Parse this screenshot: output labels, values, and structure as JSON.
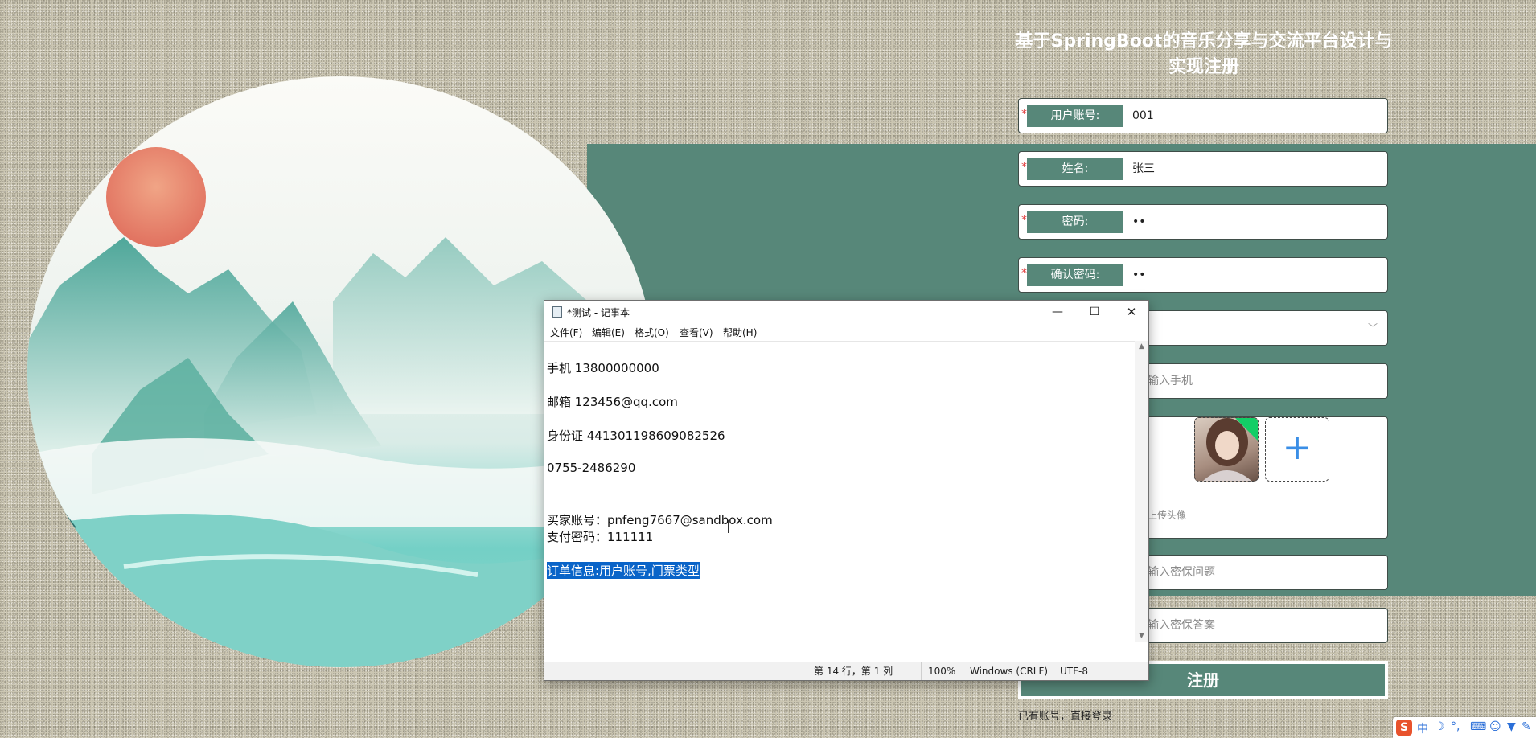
{
  "register": {
    "title": "基于SpringBoot的音乐分享与交流平台设计与实现注册",
    "fields": [
      {
        "label": "用户账号:",
        "value": "001",
        "required": true
      },
      {
        "label": "姓名:",
        "value": "张三",
        "required": true
      },
      {
        "label": "密码:",
        "value": "••",
        "required": true
      },
      {
        "label": "确认密码:",
        "value": "••",
        "required": true
      }
    ],
    "placeholders": {
      "phone": "输入手机",
      "avatar": "上传头像",
      "question": "输入密保问题",
      "answer": "输入密保答案"
    },
    "add_symbol": "+",
    "register_button": "注册",
    "login_link": "已有账号，直接登录"
  },
  "notepad": {
    "title": "*测试 - 记事本",
    "controls": {
      "minimize": "—",
      "maximize": "☐",
      "close": "✕"
    },
    "menu": [
      "文件(F)",
      "编辑(E)",
      "格式(O)",
      "查看(V)",
      "帮助(H)"
    ],
    "lines": [
      "手机 13800000000",
      "邮箱 123456@qq.com",
      "身份证 441301198609082526",
      "0755-2486290",
      "买家账号：pnfeng7667@sandbox.com",
      "支付密码：111111",
      "订单信息:用户账号,门票类型"
    ],
    "status": {
      "position": "第 14 行，第 1 列",
      "zoom": "100%",
      "line_ending": "Windows (CRLF)",
      "encoding": "UTF-8"
    }
  },
  "ime": {
    "logo": "S",
    "mode": "中",
    "icons": [
      "moon-icon",
      "punctuation-icon",
      "keyboard-icon",
      "user-icon",
      "shirt-icon",
      "wrench-icon"
    ]
  },
  "colors": {
    "accent": "#578779",
    "required": "#e03c3c",
    "selection": "#0a64c8"
  }
}
